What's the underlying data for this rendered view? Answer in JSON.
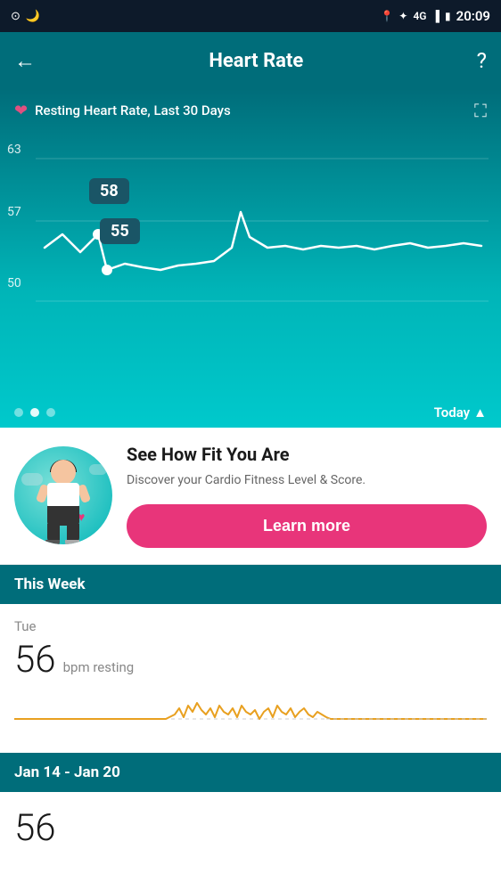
{
  "statusBar": {
    "time": "20:09",
    "icons": [
      "circle-icon",
      "moon-icon",
      "location-icon",
      "bluetooth-icon",
      "signal-icon",
      "battery-icon"
    ]
  },
  "header": {
    "title": "Heart Rate",
    "back_label": "←",
    "help_label": "?"
  },
  "chart": {
    "subtitle": "Resting Heart Rate, Last 30 Days",
    "y_labels": [
      "63",
      "57",
      "50"
    ],
    "tooltip1": "58",
    "tooltip2": "55",
    "today_label": "Today",
    "dots": [
      {
        "active": false
      },
      {
        "active": true
      },
      {
        "active": false
      }
    ]
  },
  "cardio": {
    "title": "See How Fit You Are",
    "description": "Discover your Cardio Fitness Level & Score.",
    "button_label": "Learn more"
  },
  "thisWeek": {
    "header": "This Week",
    "day": "Tue",
    "bpm": "56",
    "unit": "bpm resting"
  },
  "dateRange": {
    "label": "Jan 14 - Jan 20",
    "bpm": "56"
  }
}
